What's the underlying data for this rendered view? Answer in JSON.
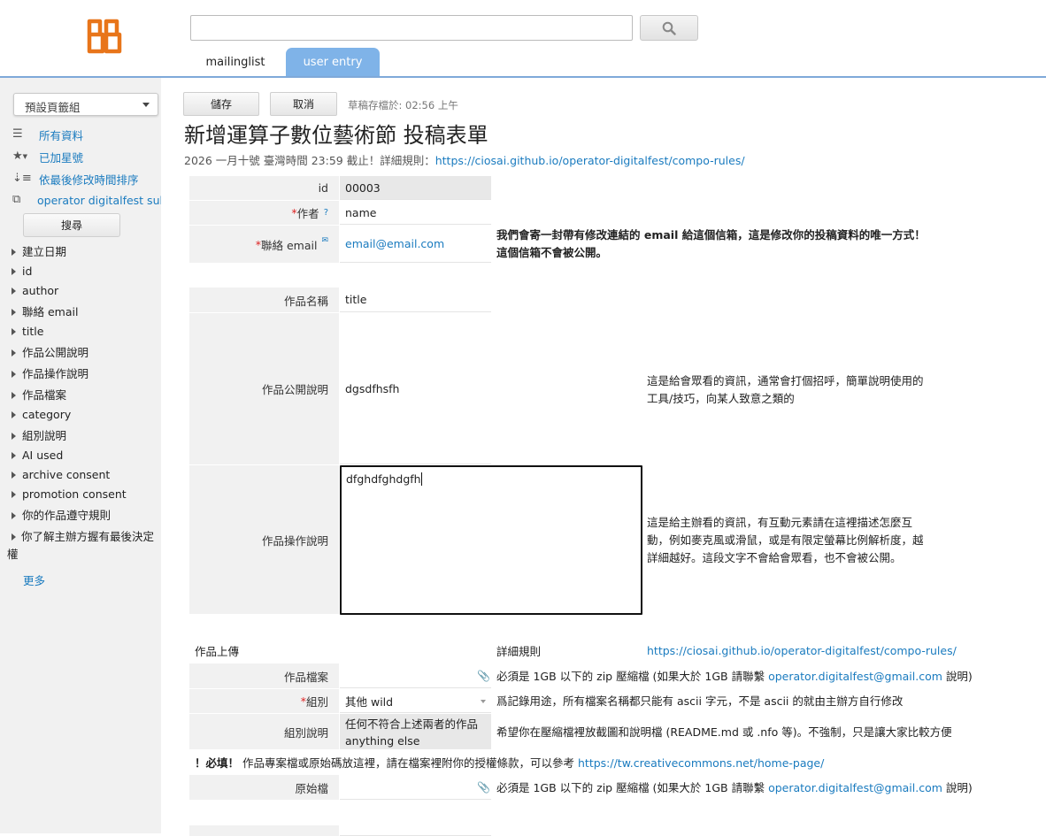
{
  "header": {
    "search_placeholder": "",
    "tabs": [
      {
        "label": "mailinglist"
      },
      {
        "label": "user entry"
      }
    ]
  },
  "sidebar": {
    "view_select": "預設頁籤組",
    "nav": [
      {
        "label": "所有資料",
        "icon": "list-icon"
      },
      {
        "label": "已加星號",
        "icon": "star-icon"
      },
      {
        "label": "依最後修改時間排序",
        "icon": "sort-icon"
      },
      {
        "label": "operator digitalfest submissions",
        "icon": "table-icon"
      }
    ],
    "search_button": "搜尋",
    "fields": [
      "建立日期",
      "id",
      "author",
      "聯絡 email",
      "title",
      "作品公開說明",
      "作品操作說明",
      "作品檔案",
      "category",
      "組別說明",
      "AI used",
      "archive consent",
      "promotion consent",
      "你的作品遵守規則",
      "你了解主辦方握有最後決定權"
    ],
    "more": "更多"
  },
  "toolbar": {
    "save_label": "儲存",
    "cancel_label": "取消",
    "draft_status": "草稿存檔於: 02:56 上午"
  },
  "form": {
    "title": "新增運算子數位藝術節 投稿表單",
    "deadline_text": "2026 一月十號 臺灣時間 23:59 截止！詳細規則：",
    "rules_url": "https://ciosai.github.io/operator-digitalfest/compo-rules/",
    "fields": {
      "id": {
        "label": "id",
        "value": "00003"
      },
      "author": {
        "label": "作者",
        "required": "*",
        "help": "?",
        "value": "name"
      },
      "email": {
        "label": "聯絡 email",
        "required": "*",
        "value": "email@email.com",
        "note_line1": "我們會寄一封帶有修改連結的 email 給這個信箱，這是修改你的投稿資料的唯一方式！",
        "note_line2": "這個信箱不會被公開。"
      },
      "title": {
        "label": "作品名稱",
        "value": "title"
      },
      "public_desc": {
        "label": "作品公開說明",
        "value": "dgsdfhsfh",
        "note_line1": "這是給會眾看的資訊，通常會打個招呼，簡單說明使用的",
        "note_line2": "工具/技巧，向某人致意之類的"
      },
      "operation_desc": {
        "label": "作品操作說明",
        "value": "dfghdfghdgfh",
        "note_line1": "這是給主辦看的資訊，有互動元素請在這裡描述怎麼互",
        "note_line2": "動，例如麥克風或滑鼠，或是有限定螢幕比例解析度，越",
        "note_line3": "詳細越好。這段文字不會給會眾看，也不會被公開。"
      }
    },
    "upload_section": {
      "heading": "作品上傳",
      "rules_label": "詳細規則",
      "rules_url": "https://ciosai.github.io/operator-digitalfest/compo-rules/"
    },
    "upload_fields": {
      "file": {
        "label": "作品檔案",
        "note_prefix": "必須是 1GB 以下的 zip 壓縮檔 (如果大於 1GB 請聯繫",
        "contact": "operator.digitalfest@gmail.com",
        "note_suffix": "說明)"
      },
      "category": {
        "label": "組別",
        "required": "*",
        "value": "其他 wild",
        "note": "爲記錄用途，所有檔案名稱都只能有 ascii 字元，不是 ascii 的就由主辦方自行修改"
      },
      "category_desc": {
        "label": "組別說明",
        "value_line1": "任何不符合上述兩者的作品",
        "value_line2": "anything else",
        "note": "希望你在壓縮檔裡放截圖和說明檔 (README.md 或 .nfo 等)。不強制，只是讓大家比較方便"
      },
      "must_fill": {
        "prefix": "！必填！",
        "text": "作品專案檔或原始碼放這裡，請在檔案裡附你的授權條款，可以參考",
        "link": "https://tw.creativecommons.net/home-page/"
      },
      "source": {
        "label": "原始檔",
        "note_prefix": "必須是 1GB 以下的 zip 壓縮檔 (如果大於 1GB 請聯繫",
        "contact": "operator.digitalfest@gmail.com",
        "note_suffix": "說明)"
      }
    }
  },
  "colors": {
    "accent": "#1a7bbf",
    "tab_active": "#7fb3e8",
    "logo": "#e8751a",
    "required": "#dd2222"
  }
}
